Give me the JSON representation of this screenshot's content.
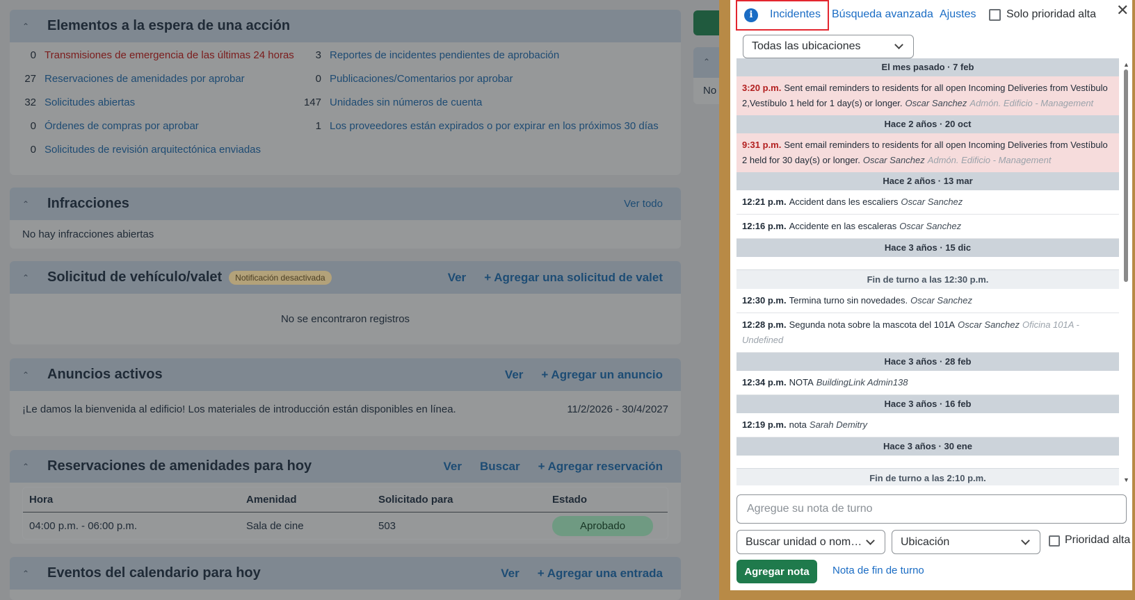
{
  "dashboard": {
    "pending": {
      "title": "Elementos a la espera de una acción",
      "left": [
        {
          "count": "0",
          "label": "Transmisiones de emergencia de las últimas 24 horas",
          "alert": true
        },
        {
          "count": "27",
          "label": "Reservaciones de amenidades por aprobar",
          "alert": false
        },
        {
          "count": "32",
          "label": "Solicitudes abiertas",
          "alert": false
        },
        {
          "count": "0",
          "label": "Órdenes de compras por aprobar",
          "alert": false
        },
        {
          "count": "0",
          "label": "Solicitudes de revisión arquitectónica enviadas",
          "alert": false
        }
      ],
      "right": [
        {
          "count": "3",
          "label": "Reportes de incidentes pendientes de aprobación"
        },
        {
          "count": "0",
          "label": "Publicaciones/Comentarios por aprobar"
        },
        {
          "count": "147",
          "label": "Unidades sin números de cuenta"
        },
        {
          "count": "1",
          "label": "Los proveedores están expirados o por expirar en los próximos 30 días"
        }
      ]
    },
    "violations": {
      "title": "Infracciones",
      "view_all": "Ver todo",
      "empty": "No hay infracciones abiertas"
    },
    "valet": {
      "title": "Solicitud de vehículo/valet",
      "badge": "Notificación desactivada",
      "view": "Ver",
      "add": "+ Agregar una solicitud de valet",
      "empty": "No se encontraron registros"
    },
    "announcements": {
      "title": "Anuncios activos",
      "view": "Ver",
      "add": "+ Agregar un anuncio",
      "text": "¡Le damos la bienvenida al edificio! Los materiales de introducción están disponibles en línea.",
      "dates": "11/2/2026 - 30/4/2027"
    },
    "reservations": {
      "title": "Reservaciones de amenidades para hoy",
      "view": "Ver",
      "search": "Buscar",
      "add": "+ Agregar reservación",
      "columns": [
        "Hora",
        "Amenidad",
        "Solicitado para",
        "Estado"
      ],
      "row": {
        "time": "04:00 p.m. - 06:00 p.m.",
        "amenity": "Sala de cine",
        "for": "503",
        "status": "Aprobado"
      }
    },
    "calendar": {
      "title": "Eventos del calendario para hoy",
      "view": "Ver",
      "add": "+ Agregar una entrada"
    },
    "side_card_text": "No"
  },
  "panel": {
    "tabs": {
      "incidents": "Incidentes",
      "advanced": "Búsqueda avanzada",
      "settings": "Ajustes",
      "high_priority": "Solo prioridad alta"
    },
    "location_filter": "Todas las ubicaciones",
    "feed": [
      {
        "kind": "date",
        "text": "El mes pasado · 7 feb"
      },
      {
        "kind": "entry",
        "alert": true,
        "time": "3:20 p.m.",
        "text": "Sent email reminders to residents for all open Incoming Deliveries from Vestíbulo 2,Vestíbulo 1 held for 1 day(s) or longer.",
        "who": "Oscar Sanchez",
        "where": "Admón. Edificio - Management"
      },
      {
        "kind": "date",
        "text": "Hace 2 años · 20 oct"
      },
      {
        "kind": "entry",
        "alert": true,
        "time": "9:31 p.m.",
        "text": "Sent email reminders to residents for all open Incoming Deliveries from Vestíbulo 2 held for 30 day(s) or longer.",
        "who": "Oscar Sanchez",
        "where": "Admón. Edificio - Management"
      },
      {
        "kind": "date",
        "text": "Hace 2 años · 13 mar"
      },
      {
        "kind": "entry",
        "alert": false,
        "time": "12:21 p.m.",
        "text": "Accident dans les escaliers",
        "who": "Oscar Sanchez",
        "where": ""
      },
      {
        "kind": "entry",
        "alert": false,
        "time": "12:16 p.m.",
        "text": "Accidente en las escaleras",
        "who": "Oscar Sanchez",
        "where": ""
      },
      {
        "kind": "date",
        "text": "Hace 3 años · 15 dic"
      },
      {
        "kind": "shift",
        "text": "Fin de turno a las 12:30 p.m."
      },
      {
        "kind": "entry",
        "alert": false,
        "time": "12:30 p.m.",
        "text": "Termina turno sin novedades.",
        "who": "Oscar Sanchez",
        "where": ""
      },
      {
        "kind": "entry",
        "alert": false,
        "time": "12:28 p.m.",
        "text": "Segunda nota sobre la mascota del 101A",
        "who": "Oscar Sanchez",
        "where": "Oficina 101A - Undefined"
      },
      {
        "kind": "date",
        "text": "Hace 3 años · 28 feb"
      },
      {
        "kind": "entry",
        "alert": false,
        "time": "12:34 p.m.",
        "text": "NOTA",
        "who": "BuildingLink Admin138",
        "where": ""
      },
      {
        "kind": "date",
        "text": "Hace 3 años · 16 feb"
      },
      {
        "kind": "entry",
        "alert": false,
        "time": "12:19 p.m.",
        "text": "nota",
        "who": "Sarah Demitry",
        "where": ""
      },
      {
        "kind": "date",
        "text": "Hace 3 años · 30 ene"
      },
      {
        "kind": "shift",
        "text": "Fin de turno a las 2:10 p.m."
      }
    ],
    "note_placeholder": "Agregue su nota de turno",
    "unit_select": "Buscar unidad o nom…",
    "location_select": "Ubicación",
    "priority_label": "Prioridad alta",
    "add_note": "Agregar nota",
    "end_shift_note": "Nota de fin de turno"
  }
}
